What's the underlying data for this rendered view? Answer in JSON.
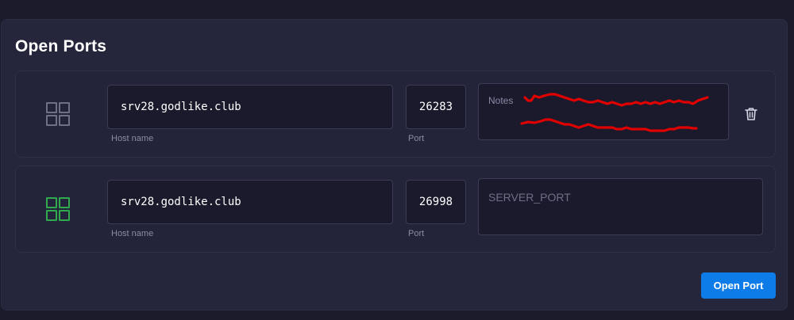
{
  "panel": {
    "title": "Open Ports"
  },
  "ports": [
    {
      "host": "srv28.godlike.club",
      "host_label": "Host name",
      "port": "26283",
      "port_label": "Port",
      "notes_placeholder": "Notes",
      "notes_redacted": true,
      "status_icon": "grid-icon",
      "status_color": "#6e7088"
    },
    {
      "host": "srv28.godlike.club",
      "host_label": "Host name",
      "port": "26998",
      "port_label": "Port",
      "notes_value": "SERVER_PORT",
      "status_icon": "grid-icon",
      "status_color": "#2faa4d"
    }
  ],
  "actions": {
    "delete_icon": "trash-icon",
    "open_port_label": "Open Port"
  },
  "colors": {
    "accent": "#0d7ce8",
    "active": "#2faa4d",
    "redaction": "#e00000"
  }
}
